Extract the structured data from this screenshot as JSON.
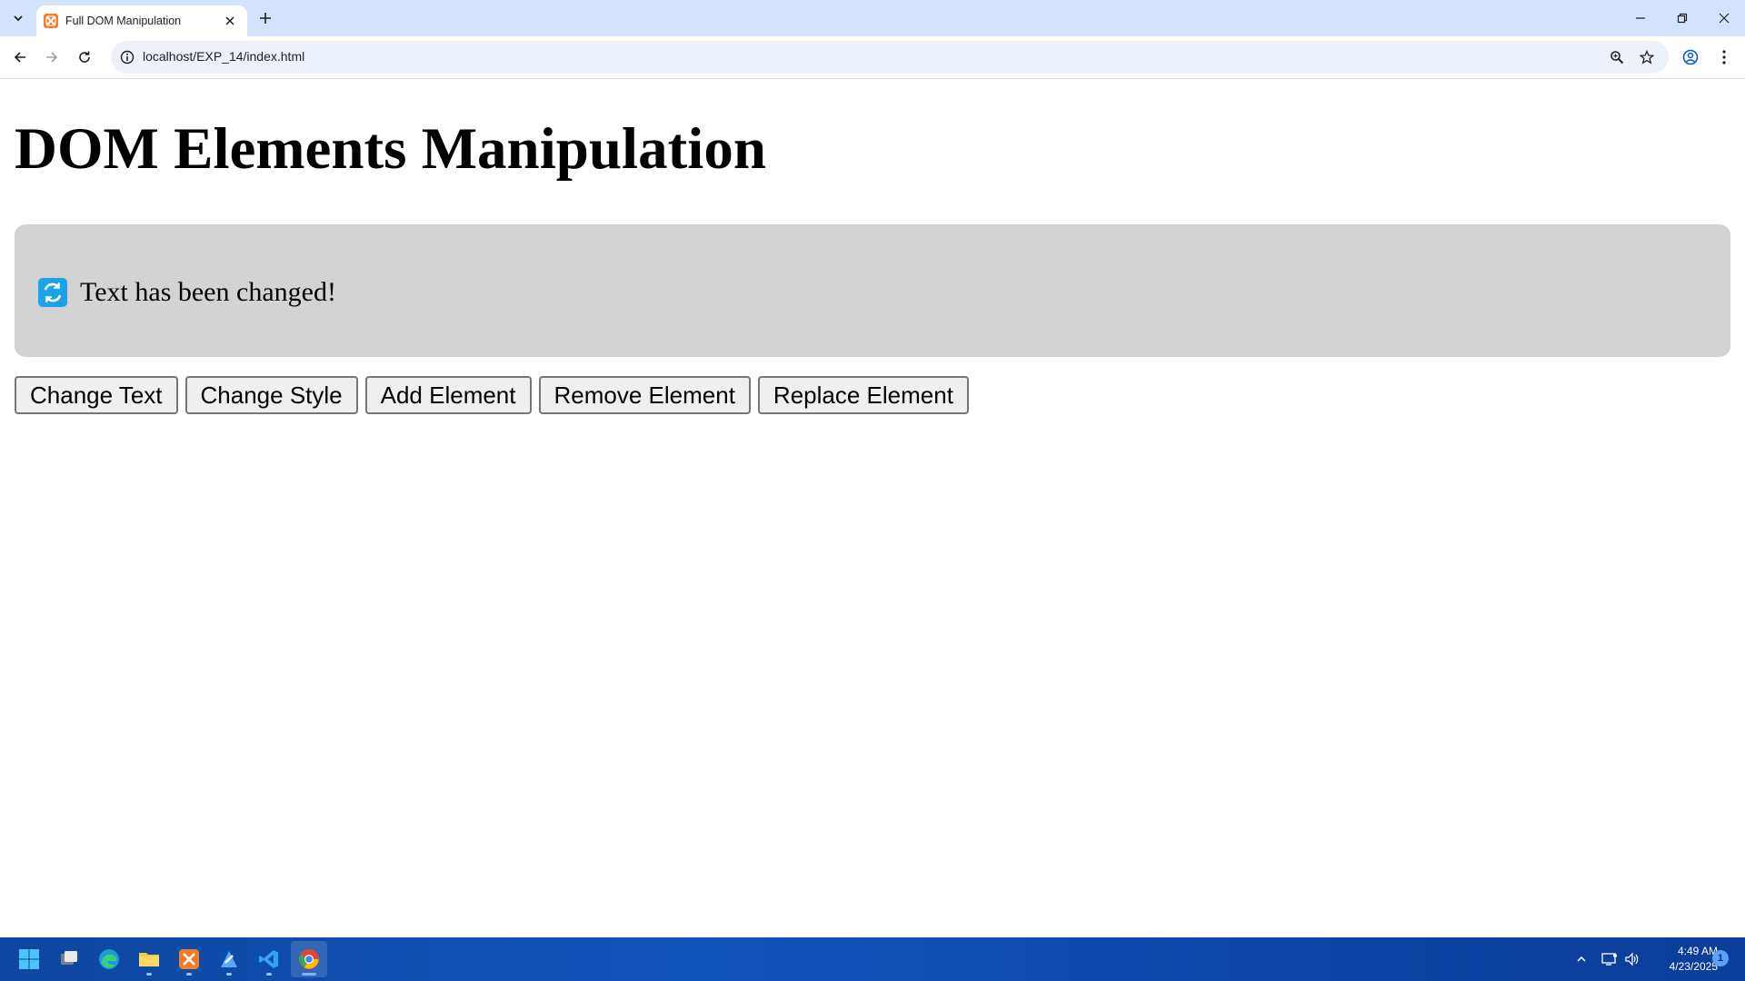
{
  "browser": {
    "tab_title": "Full DOM Manipulation",
    "url": "localhost/EXP_14/index.html",
    "accent_color": "#d3e3fd"
  },
  "page": {
    "heading": "DOM Elements Manipulation",
    "content_text": "Text has been changed!",
    "content_box_color": "#d3d3d3",
    "buttons": {
      "change_text": "Change Text",
      "change_style": "Change Style",
      "add_element": "Add Element",
      "remove_element": "Remove Element",
      "replace_element": "Replace Element"
    }
  },
  "taskbar": {
    "apps": [
      "windows-start-icon",
      "task-view-icon",
      "edge-icon",
      "file-explorer-icon",
      "xampp-icon",
      "app-icon",
      "vscode-icon",
      "chrome-icon"
    ],
    "time": "4:49 AM",
    "date": "4/23/2025",
    "notification_count": "1"
  }
}
